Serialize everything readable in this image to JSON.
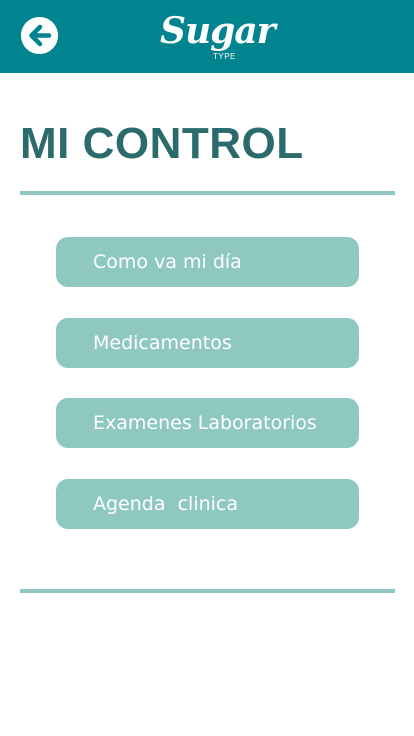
{
  "header": {
    "back_icon": "arrow-left-icon",
    "logo_text": "Sugar",
    "logo_subtext": "TYPE"
  },
  "page": {
    "title": "MI CONTROL"
  },
  "menu": {
    "items": [
      {
        "label": "Como va mi día"
      },
      {
        "label": "Medicamentos"
      },
      {
        "label": "Examenes Laboratorios"
      },
      {
        "label": "Agenda  clinica"
      }
    ]
  },
  "colors": {
    "header_bg": "#028390",
    "title": "#2b6b6c",
    "accent": "#8ec8c0",
    "button_text": "#ffffff"
  }
}
